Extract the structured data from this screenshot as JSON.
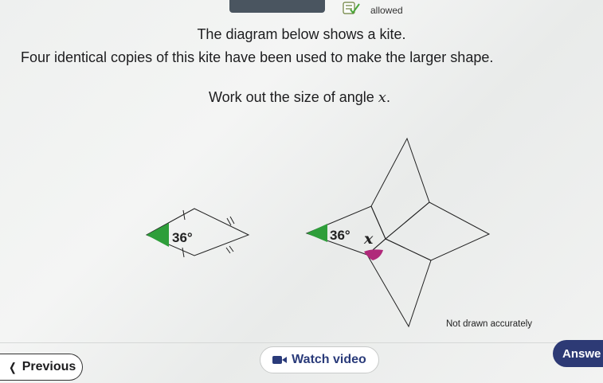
{
  "header": {
    "allowed_label": "allowed"
  },
  "question": {
    "line1": "The diagram below shows a kite.",
    "line2": "Four identical copies of this kite have been used to make the larger shape.",
    "line3_prefix": "Work out the size of angle ",
    "line3_var": "x",
    "line3_suffix": "."
  },
  "diagram": {
    "kite_angle_label": "36°",
    "shape_angle_label": "36°",
    "unknown_label": "x",
    "note": "Not drawn accurately"
  },
  "footer": {
    "previous_label": "Previous",
    "watch_label": "Watch video",
    "answer_label": "Answe"
  },
  "colors": {
    "green": "#2e9e3a",
    "purple": "#b0297a",
    "button_blue": "#2d3a75"
  }
}
